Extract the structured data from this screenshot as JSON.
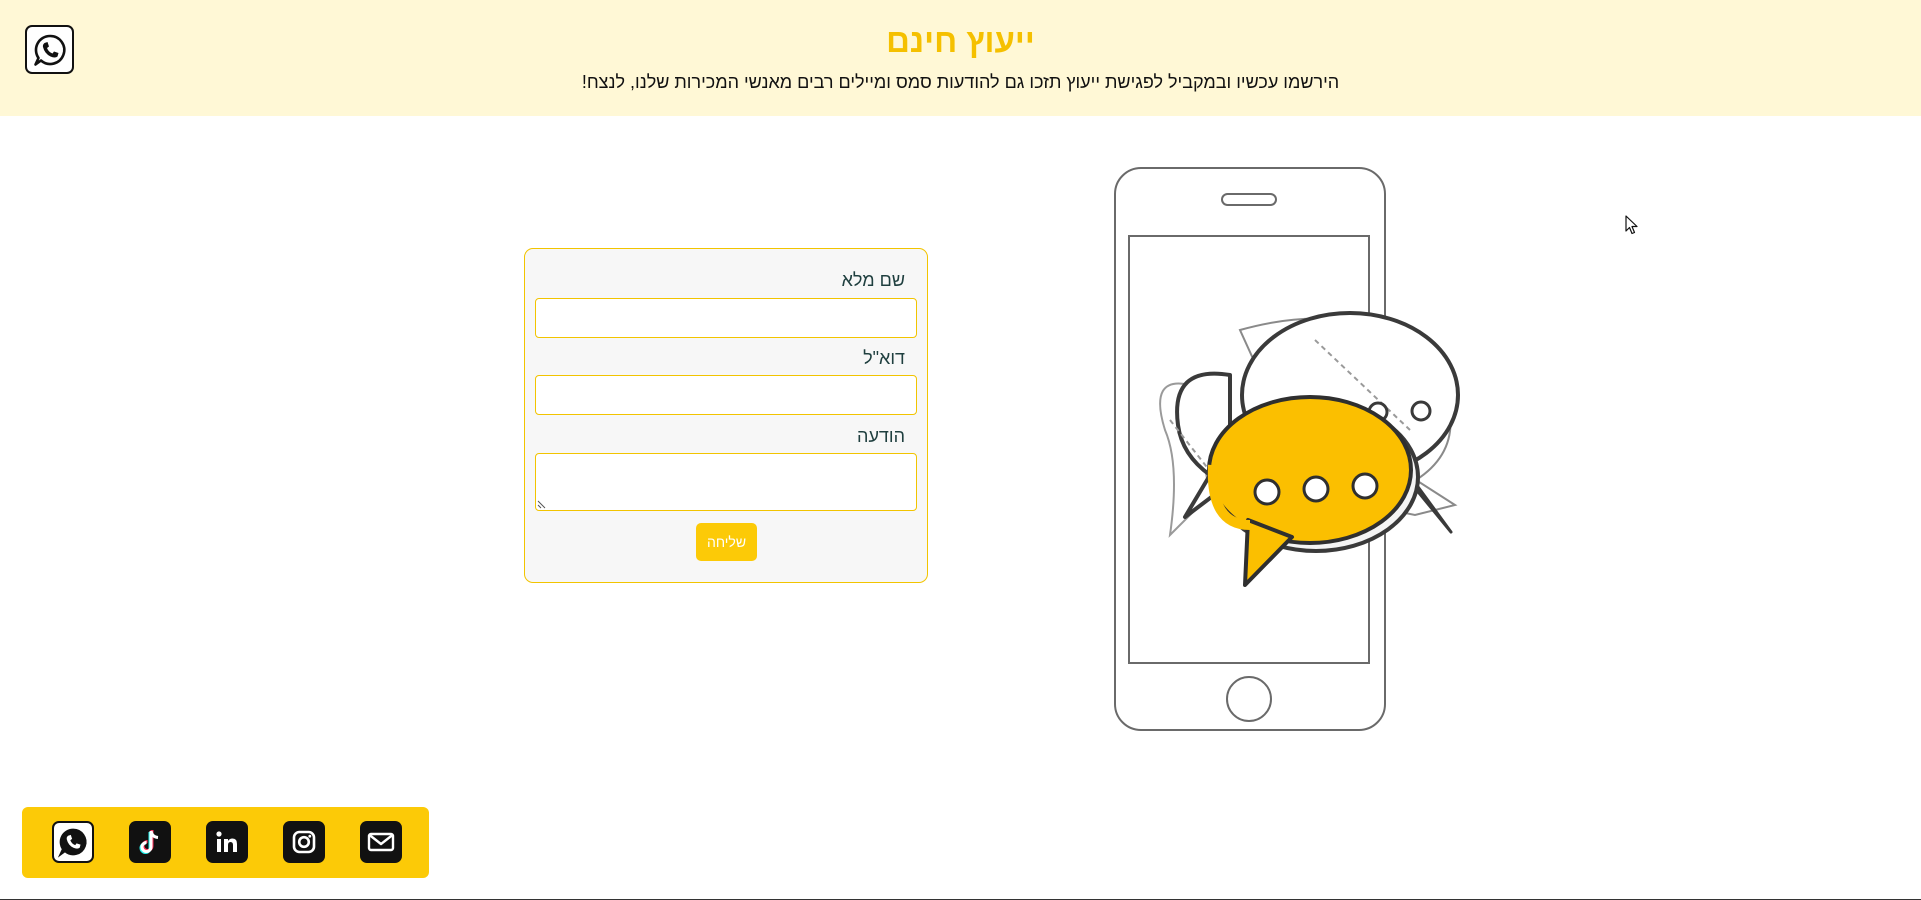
{
  "header": {
    "title": "ייעוץ חינם",
    "subtitle": "הירשמו עכשיו ובמקביל לפגישת ייעוץ תזכו גם להודעות סמס ומיילים רבים מאנשי המכירות שלנו, לנצח!"
  },
  "form": {
    "fullname_label": "שם מלא",
    "fullname_value": "",
    "email_label": "דוא\"ל",
    "email_value": "",
    "message_label": "הודעה",
    "message_value": "",
    "submit_label": "שליחה"
  },
  "icons": {
    "top": "whatsapp-icon",
    "social": [
      "whatsapp-icon",
      "tiktok-icon",
      "linkedin-icon",
      "instagram-icon",
      "mail-icon"
    ]
  },
  "colors": {
    "accent": "#fcca07",
    "header_bg": "#fff8d6",
    "title": "#f5c000"
  }
}
